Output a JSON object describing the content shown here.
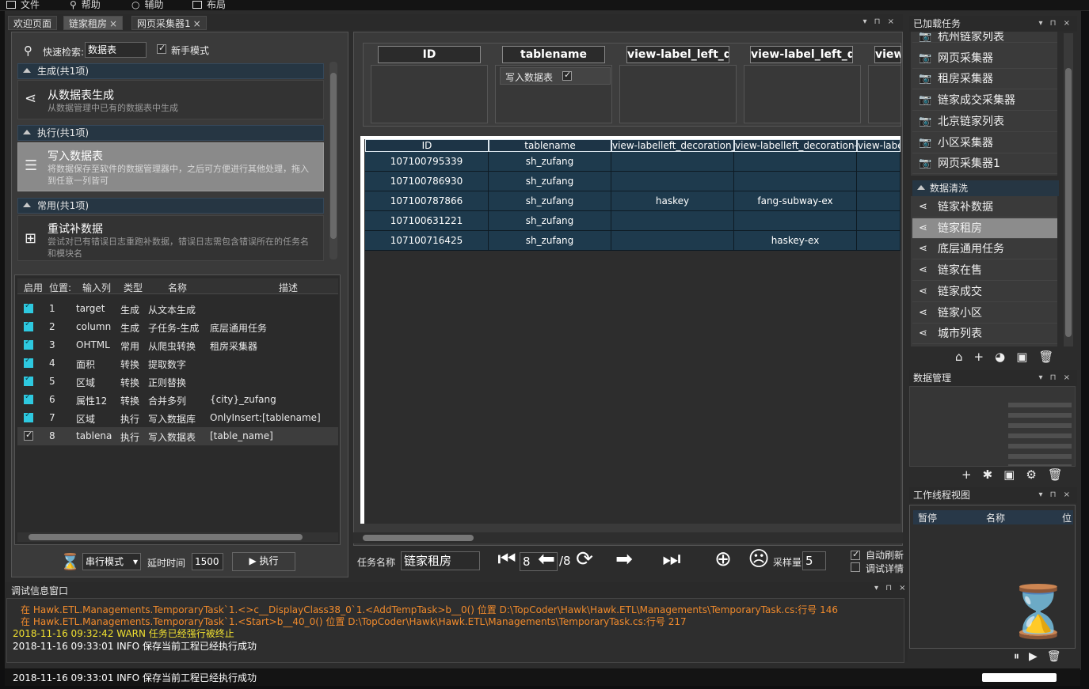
{
  "menu": [
    {
      "label": "文件",
      "icon": "square-icon"
    },
    {
      "label": "帮助",
      "icon": "search-icon"
    },
    {
      "label": "辅助",
      "icon": "circle-icon"
    },
    {
      "label": "布局",
      "icon": "grid-icon"
    }
  ],
  "doc_tabs": [
    {
      "label": "欢迎页面"
    },
    {
      "label": "链家租房",
      "close": "×"
    },
    {
      "label": "网页采集器1",
      "close": "×"
    }
  ],
  "left": {
    "search_label": "快速检索:",
    "search_value": "数据表",
    "novice_label": "新手模式",
    "groups": [
      {
        "title": "生成(共1项)",
        "item_title": "从数据表生成",
        "item_desc": "从数据管理中已有的数据表中生成"
      },
      {
        "title": "执行(共1项)",
        "item_title": "写入数据表",
        "item_desc": "将数据保存至软件的数据管理器中，之后可方便进行其他处理，拖入到任意一列皆可"
      },
      {
        "title": "常用(共1项)",
        "item_title": "重试补数据",
        "item_desc": "尝试对已有错误日志重跑补数据，错误日志需包含错误所在的任务名和模块名"
      }
    ],
    "grid_headers": [
      "启用",
      "位置:",
      "输入列",
      "类型",
      "名称",
      "描述"
    ],
    "rows": [
      {
        "pos": "1",
        "col": "target",
        "type": "生成",
        "name": "从文本生成",
        "desc": ""
      },
      {
        "pos": "2",
        "col": "column",
        "type": "生成",
        "name": "子任务-生成",
        "desc": "底层通用任务"
      },
      {
        "pos": "3",
        "col": "OHTML",
        "type": "常用",
        "name": "从爬虫转换",
        "desc": "租房采集器"
      },
      {
        "pos": "4",
        "col": "面积",
        "type": "转换",
        "name": "提取数字",
        "desc": ""
      },
      {
        "pos": "5",
        "col": "区域",
        "type": "转换",
        "name": "正则替换",
        "desc": ""
      },
      {
        "pos": "6",
        "col": "属性12",
        "type": "转换",
        "name": "合并多列",
        "desc": "{city}_zufang"
      },
      {
        "pos": "7",
        "col": "区域",
        "type": "执行",
        "name": "写入数据库",
        "desc": "OnlyInsert:[tablename]"
      },
      {
        "pos": "8",
        "col": "tablena",
        "type": "执行",
        "name": "写入数据表",
        "desc": "[table_name]"
      }
    ],
    "mode_value": "串行模式",
    "delay_label": "延时时间",
    "delay_value": "1500",
    "execute_label": "执行"
  },
  "center": {
    "prop_headers": [
      "ID",
      "tablename",
      "view-label_left_d",
      "view-label_left_d",
      "view"
    ],
    "prop_write_label": "写入数据表",
    "table_headers": [
      "ID",
      "tablename",
      "view-labelleft_decoration_c",
      "view-labelleft_decoration-c",
      "view-labe"
    ],
    "table_rows": [
      [
        "107100795339",
        "sh_zufang",
        "",
        ""
      ],
      [
        "107100786930",
        "sh_zufang",
        "",
        ""
      ],
      [
        "107100787866",
        "sh_zufang",
        "haskey",
        "fang-subway-ex"
      ],
      [
        "107100631221",
        "sh_zufang",
        "",
        ""
      ],
      [
        "107100716425",
        "sh_zufang",
        "",
        "haskey-ex"
      ]
    ],
    "task_name_label": "任务名称",
    "task_name_value": "链家租房",
    "page_current": "8",
    "page_total": "/8",
    "sample_label": "采样量",
    "sample_value": "5",
    "auto_refresh_label": "自动刷新",
    "debug_detail_label": "调试详情"
  },
  "right": {
    "loaded_tasks_title": "已加载任务",
    "loaded_tasks": [
      "杭州链家列表",
      "网页采集器",
      "租房采集器",
      "链家成交采集器",
      "北京链家列表",
      "小区采集器",
      "网页采集器1"
    ],
    "cleaning_title": "数据清洗",
    "cleaning_tasks": [
      "链家补数据",
      "链家租房",
      "底层通用任务",
      "链家在售",
      "链家成交",
      "链家小区",
      "城市列表"
    ],
    "data_mgmt_title": "数据管理",
    "thread_view_title": "工作线程视图",
    "thread_headers": [
      "暂停",
      "名称",
      "位"
    ]
  },
  "log": {
    "title": "调试信息窗口",
    "lines": [
      {
        "text": "在 Hawk.ETL.Managements.TemporaryTask`1.<>c__DisplayClass38_0`1.<AddTempTask>b__0() 位置 D:\\TopCoder\\Hawk\\Hawk.ETL\\Managements\\TemporaryTask.cs:行号 146",
        "color": "#f08a2c"
      },
      {
        "text": "在 Hawk.ETL.Managements.TemporaryTask`1.<Start>b__40_0() 位置 D:\\TopCoder\\Hawk\\Hawk.ETL\\Managements\\TemporaryTask.cs:行号 217",
        "color": "#f08a2c"
      },
      {
        "text": "2018-11-16 09:32:42 WARN  任务已经强行被终止",
        "color": "#f0e030"
      },
      {
        "text": "2018-11-16 09:33:01 INFO  保存当前工程已经执行成功",
        "color": "#ffffff"
      }
    ]
  },
  "status_text": "2018-11-16 09:33:01 INFO  保存当前工程已经执行成功"
}
